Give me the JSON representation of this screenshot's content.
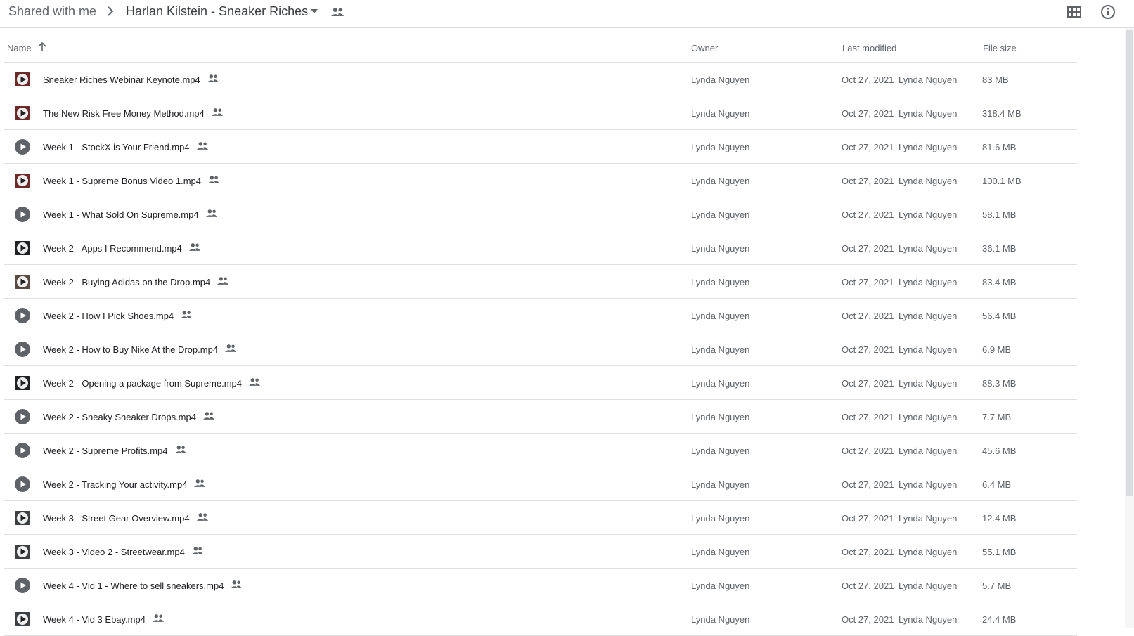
{
  "breadcrumb": {
    "root": "Shared with me",
    "current": "Harlan Kilstein - Sneaker Riches"
  },
  "icons": {
    "separator": "chevron-right-icon",
    "dropdown": "caret-down-icon",
    "shared": "people-icon",
    "grid": "grid-view-icon",
    "info": "info-icon",
    "sort": "arrow-up-icon",
    "video": "play-icon"
  },
  "colors": {
    "text": "#202124",
    "muted": "#5f6368",
    "divider": "#e0e0e0",
    "thumb_dark": "#3c4043"
  },
  "table": {
    "headers": {
      "name": "Name",
      "owner": "Owner",
      "modified": "Last modified",
      "size": "File size"
    },
    "rows": [
      {
        "name": "Sneaker Riches Webinar Keynote.mp4",
        "owner": "Lynda Nguyen",
        "modified": "Oct 27, 2021",
        "modified_by": "Lynda Nguyen",
        "size": "83 MB",
        "thumb": "red"
      },
      {
        "name": "The New Risk Free Money Method.mp4",
        "owner": "Lynda Nguyen",
        "modified": "Oct 27, 2021",
        "modified_by": "Lynda Nguyen",
        "size": "318.4 MB",
        "thumb": "red"
      },
      {
        "name": "Week 1 - StockX is Your Friend.mp4",
        "owner": "Lynda Nguyen",
        "modified": "Oct 27, 2021",
        "modified_by": "Lynda Nguyen",
        "size": "81.6 MB",
        "thumb": "circle"
      },
      {
        "name": "Week 1 - Supreme Bonus Video 1.mp4",
        "owner": "Lynda Nguyen",
        "modified": "Oct 27, 2021",
        "modified_by": "Lynda Nguyen",
        "size": "100.1 MB",
        "thumb": "red"
      },
      {
        "name": "Week 1 - What Sold On Supreme.mp4",
        "owner": "Lynda Nguyen",
        "modified": "Oct 27, 2021",
        "modified_by": "Lynda Nguyen",
        "size": "58.1 MB",
        "thumb": "circle"
      },
      {
        "name": "Week 2 - Apps I Recommend.mp4",
        "owner": "Lynda Nguyen",
        "modified": "Oct 27, 2021",
        "modified_by": "Lynda Nguyen",
        "size": "36.1 MB",
        "thumb": "dark"
      },
      {
        "name": "Week 2 - Buying Adidas on the Drop.mp4",
        "owner": "Lynda Nguyen",
        "modified": "Oct 27, 2021",
        "modified_by": "Lynda Nguyen",
        "size": "83.4 MB",
        "thumb": "brown"
      },
      {
        "name": "Week 2 - How I Pick Shoes.mp4",
        "owner": "Lynda Nguyen",
        "modified": "Oct 27, 2021",
        "modified_by": "Lynda Nguyen",
        "size": "56.4 MB",
        "thumb": "circle"
      },
      {
        "name": "Week 2 - How to Buy Nike At the Drop.mp4",
        "owner": "Lynda Nguyen",
        "modified": "Oct 27, 2021",
        "modified_by": "Lynda Nguyen",
        "size": "6.9 MB",
        "thumb": "circle"
      },
      {
        "name": "Week 2 - Opening a package from Supreme.mp4",
        "owner": "Lynda Nguyen",
        "modified": "Oct 27, 2021",
        "modified_by": "Lynda Nguyen",
        "size": "88.3 MB",
        "thumb": "dark"
      },
      {
        "name": "Week 2 - Sneaky Sneaker Drops.mp4",
        "owner": "Lynda Nguyen",
        "modified": "Oct 27, 2021",
        "modified_by": "Lynda Nguyen",
        "size": "7.7 MB",
        "thumb": "circle"
      },
      {
        "name": "Week 2 - Supreme Profits.mp4",
        "owner": "Lynda Nguyen",
        "modified": "Oct 27, 2021",
        "modified_by": "Lynda Nguyen",
        "size": "45.6 MB",
        "thumb": "circle"
      },
      {
        "name": "Week 2 - Tracking Your activity.mp4",
        "owner": "Lynda Nguyen",
        "modified": "Oct 27, 2021",
        "modified_by": "Lynda Nguyen",
        "size": "6.4 MB",
        "thumb": "circle"
      },
      {
        "name": "Week 3 - Street Gear Overview.mp4",
        "owner": "Lynda Nguyen",
        "modified": "Oct 27, 2021",
        "modified_by": "Lynda Nguyen",
        "size": "12.4 MB",
        "thumb": "frame"
      },
      {
        "name": "Week 3 - Video 2 - Streetwear.mp4",
        "owner": "Lynda Nguyen",
        "modified": "Oct 27, 2021",
        "modified_by": "Lynda Nguyen",
        "size": "55.1 MB",
        "thumb": "frame"
      },
      {
        "name": "Week 4 - Vid 1 - Where to sell sneakers.mp4",
        "owner": "Lynda Nguyen",
        "modified": "Oct 27, 2021",
        "modified_by": "Lynda Nguyen",
        "size": "5.7 MB",
        "thumb": "circle"
      },
      {
        "name": "Week 4 - Vid 3 Ebay.mp4",
        "owner": "Lynda Nguyen",
        "modified": "Oct 27, 2021",
        "modified_by": "Lynda Nguyen",
        "size": "24.4 MB",
        "thumb": "frame"
      }
    ]
  }
}
